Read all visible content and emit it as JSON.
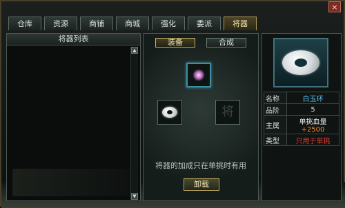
{
  "window": {
    "close_label": "×"
  },
  "tabs": [
    {
      "label": "仓库",
      "active": false
    },
    {
      "label": "资源",
      "active": false
    },
    {
      "label": "商铺",
      "active": false
    },
    {
      "label": "商城",
      "active": false
    },
    {
      "label": "强化",
      "active": false
    },
    {
      "label": "委派",
      "active": false
    },
    {
      "label": "将器",
      "active": true
    }
  ],
  "list_panel": {
    "title": "将器列表",
    "scroll_up": "▲",
    "scroll_down": "▼"
  },
  "center": {
    "subtabs": [
      {
        "label": "装备",
        "active": true
      },
      {
        "label": "合成",
        "active": false
      }
    ],
    "hint": "将器的加成只在单挑时有用",
    "unload_label": "卸载",
    "empty_slot_glyph": "将"
  },
  "info": {
    "rows": [
      {
        "key": "名称",
        "value": "白玉环"
      },
      {
        "key": "品阶",
        "value": "5"
      },
      {
        "key": "主属",
        "value": "单挑血量",
        "plus": "+2500"
      },
      {
        "key": "类型",
        "value": "只用于单挑"
      }
    ]
  },
  "colors": {
    "name_color": "#5cc8ff",
    "bonus_color": "#ff8f2a",
    "type_color": "#e03a2f",
    "tab_active_border": "#b29a57"
  }
}
